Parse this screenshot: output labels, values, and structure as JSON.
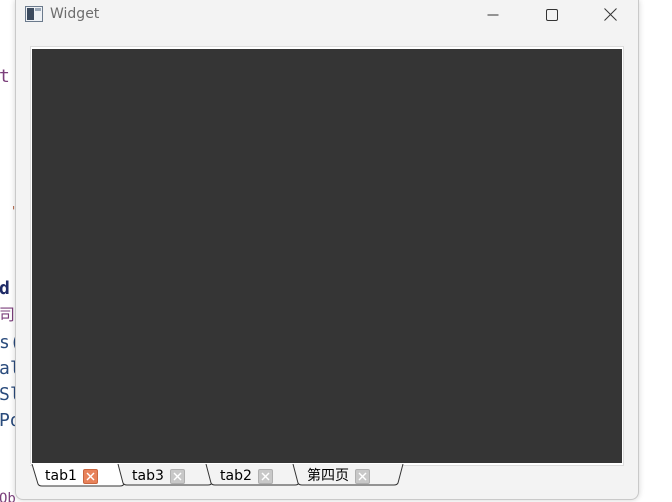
{
  "window": {
    "title": "Widget",
    "icon": "app-window-icon"
  },
  "controls": {
    "minimize_icon": "minimize-icon",
    "maximize_icon": "maximize-icon",
    "close_icon": "close-icon"
  },
  "background_editor": {
    "fragments": [
      "t",
      "d",
      "司",
      "s(",
      "al",
      "Sl",
      "Po",
      "Ob"
    ]
  },
  "tabs": [
    {
      "label": "tab1",
      "active": true,
      "close_icon": "tab-close-icon"
    },
    {
      "label": "tab3",
      "active": false,
      "close_icon": "tab-close-icon"
    },
    {
      "label": "tab2",
      "active": false,
      "close_icon": "tab-close-icon"
    },
    {
      "label": "第四页",
      "active": false,
      "close_icon": "tab-close-icon"
    }
  ],
  "colors": {
    "panel": "#353535",
    "active_close": "#e8825a",
    "inactive_close": "#c0c0c0",
    "window_bg": "#f3f3f3"
  }
}
